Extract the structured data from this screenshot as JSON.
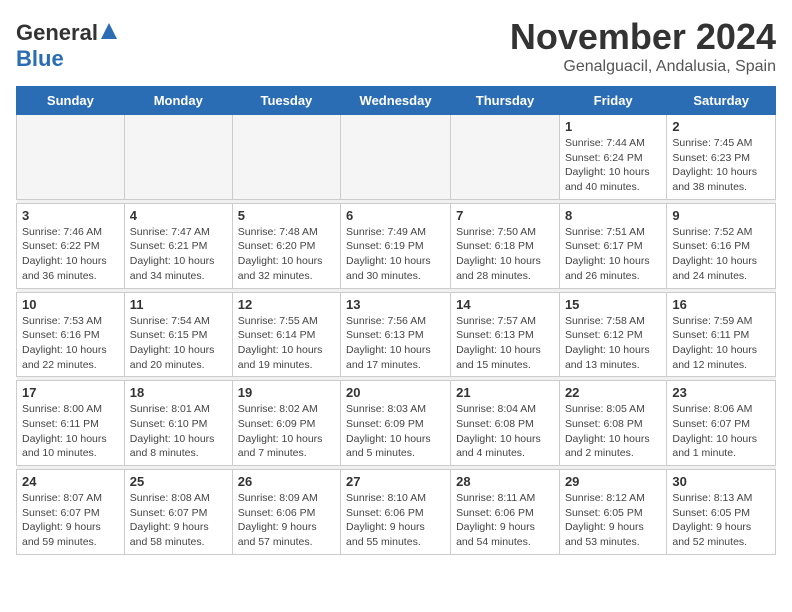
{
  "logo": {
    "general": "General",
    "blue": "Blue"
  },
  "title": {
    "month": "November 2024",
    "location": "Genalguacil, Andalusia, Spain"
  },
  "weekdays": [
    "Sunday",
    "Monday",
    "Tuesday",
    "Wednesday",
    "Thursday",
    "Friday",
    "Saturday"
  ],
  "weeks": [
    {
      "days": [
        {
          "num": "",
          "info": ""
        },
        {
          "num": "",
          "info": ""
        },
        {
          "num": "",
          "info": ""
        },
        {
          "num": "",
          "info": ""
        },
        {
          "num": "",
          "info": ""
        },
        {
          "num": "1",
          "info": "Sunrise: 7:44 AM\nSunset: 6:24 PM\nDaylight: 10 hours and 40 minutes."
        },
        {
          "num": "2",
          "info": "Sunrise: 7:45 AM\nSunset: 6:23 PM\nDaylight: 10 hours and 38 minutes."
        }
      ]
    },
    {
      "days": [
        {
          "num": "3",
          "info": "Sunrise: 7:46 AM\nSunset: 6:22 PM\nDaylight: 10 hours and 36 minutes."
        },
        {
          "num": "4",
          "info": "Sunrise: 7:47 AM\nSunset: 6:21 PM\nDaylight: 10 hours and 34 minutes."
        },
        {
          "num": "5",
          "info": "Sunrise: 7:48 AM\nSunset: 6:20 PM\nDaylight: 10 hours and 32 minutes."
        },
        {
          "num": "6",
          "info": "Sunrise: 7:49 AM\nSunset: 6:19 PM\nDaylight: 10 hours and 30 minutes."
        },
        {
          "num": "7",
          "info": "Sunrise: 7:50 AM\nSunset: 6:18 PM\nDaylight: 10 hours and 28 minutes."
        },
        {
          "num": "8",
          "info": "Sunrise: 7:51 AM\nSunset: 6:17 PM\nDaylight: 10 hours and 26 minutes."
        },
        {
          "num": "9",
          "info": "Sunrise: 7:52 AM\nSunset: 6:16 PM\nDaylight: 10 hours and 24 minutes."
        }
      ]
    },
    {
      "days": [
        {
          "num": "10",
          "info": "Sunrise: 7:53 AM\nSunset: 6:16 PM\nDaylight: 10 hours and 22 minutes."
        },
        {
          "num": "11",
          "info": "Sunrise: 7:54 AM\nSunset: 6:15 PM\nDaylight: 10 hours and 20 minutes."
        },
        {
          "num": "12",
          "info": "Sunrise: 7:55 AM\nSunset: 6:14 PM\nDaylight: 10 hours and 19 minutes."
        },
        {
          "num": "13",
          "info": "Sunrise: 7:56 AM\nSunset: 6:13 PM\nDaylight: 10 hours and 17 minutes."
        },
        {
          "num": "14",
          "info": "Sunrise: 7:57 AM\nSunset: 6:13 PM\nDaylight: 10 hours and 15 minutes."
        },
        {
          "num": "15",
          "info": "Sunrise: 7:58 AM\nSunset: 6:12 PM\nDaylight: 10 hours and 13 minutes."
        },
        {
          "num": "16",
          "info": "Sunrise: 7:59 AM\nSunset: 6:11 PM\nDaylight: 10 hours and 12 minutes."
        }
      ]
    },
    {
      "days": [
        {
          "num": "17",
          "info": "Sunrise: 8:00 AM\nSunset: 6:11 PM\nDaylight: 10 hours and 10 minutes."
        },
        {
          "num": "18",
          "info": "Sunrise: 8:01 AM\nSunset: 6:10 PM\nDaylight: 10 hours and 8 minutes."
        },
        {
          "num": "19",
          "info": "Sunrise: 8:02 AM\nSunset: 6:09 PM\nDaylight: 10 hours and 7 minutes."
        },
        {
          "num": "20",
          "info": "Sunrise: 8:03 AM\nSunset: 6:09 PM\nDaylight: 10 hours and 5 minutes."
        },
        {
          "num": "21",
          "info": "Sunrise: 8:04 AM\nSunset: 6:08 PM\nDaylight: 10 hours and 4 minutes."
        },
        {
          "num": "22",
          "info": "Sunrise: 8:05 AM\nSunset: 6:08 PM\nDaylight: 10 hours and 2 minutes."
        },
        {
          "num": "23",
          "info": "Sunrise: 8:06 AM\nSunset: 6:07 PM\nDaylight: 10 hours and 1 minute."
        }
      ]
    },
    {
      "days": [
        {
          "num": "24",
          "info": "Sunrise: 8:07 AM\nSunset: 6:07 PM\nDaylight: 9 hours and 59 minutes."
        },
        {
          "num": "25",
          "info": "Sunrise: 8:08 AM\nSunset: 6:07 PM\nDaylight: 9 hours and 58 minutes."
        },
        {
          "num": "26",
          "info": "Sunrise: 8:09 AM\nSunset: 6:06 PM\nDaylight: 9 hours and 57 minutes."
        },
        {
          "num": "27",
          "info": "Sunrise: 8:10 AM\nSunset: 6:06 PM\nDaylight: 9 hours and 55 minutes."
        },
        {
          "num": "28",
          "info": "Sunrise: 8:11 AM\nSunset: 6:06 PM\nDaylight: 9 hours and 54 minutes."
        },
        {
          "num": "29",
          "info": "Sunrise: 8:12 AM\nSunset: 6:05 PM\nDaylight: 9 hours and 53 minutes."
        },
        {
          "num": "30",
          "info": "Sunrise: 8:13 AM\nSunset: 6:05 PM\nDaylight: 9 hours and 52 minutes."
        }
      ]
    }
  ]
}
